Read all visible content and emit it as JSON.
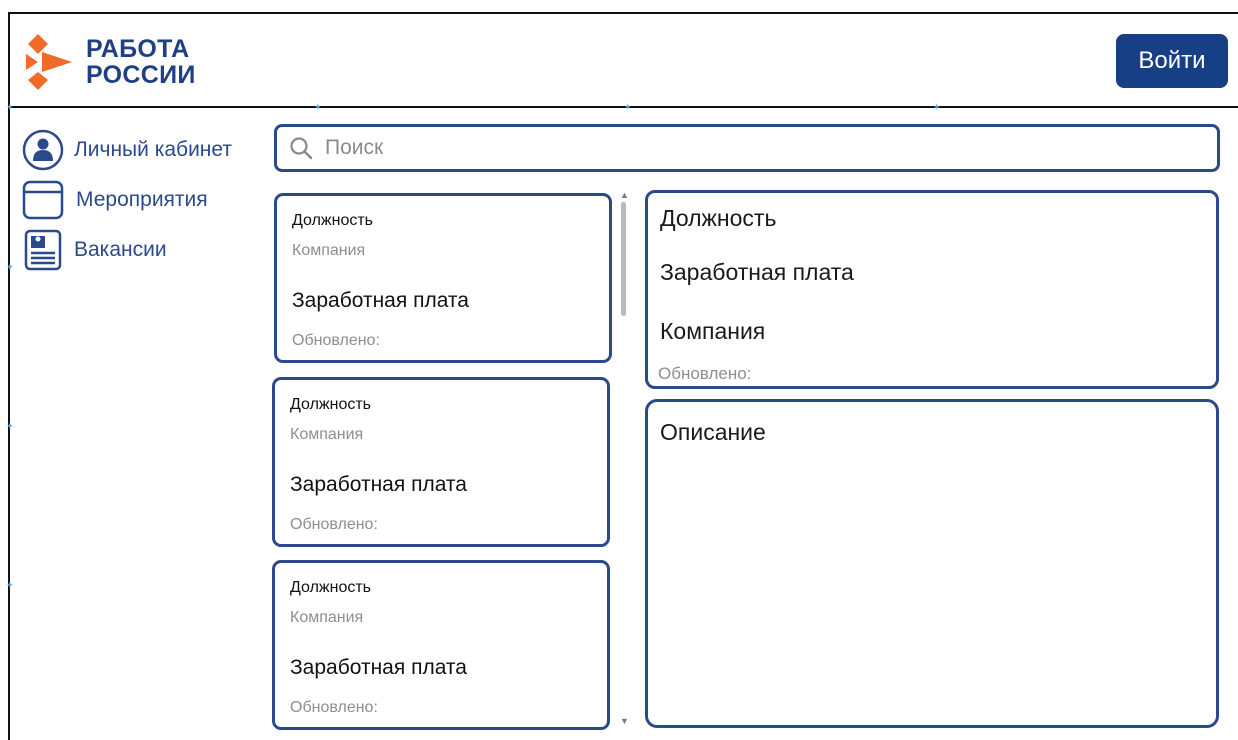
{
  "brand": {
    "line1": "РАБОТА",
    "line2": "РОССИИ",
    "color": "#1f3f86",
    "accent": "#f26a2a"
  },
  "header": {
    "login_label": "Войти"
  },
  "sidebar": {
    "items": [
      {
        "label": "Личный кабинет",
        "icon": "user-circle-icon"
      },
      {
        "label": "Мероприятия",
        "icon": "calendar-icon"
      },
      {
        "label": "Вакансии",
        "icon": "document-icon"
      }
    ]
  },
  "search": {
    "placeholder": "Поиск",
    "icon": "search-icon"
  },
  "vacancies": [
    {
      "position": "Должность",
      "company": "Компания",
      "salary": "Заработная плата",
      "updated": "Обновлено:"
    },
    {
      "position": "Должность",
      "company": "Компания",
      "salary": "Заработная плата",
      "updated": "Обновлено:"
    },
    {
      "position": "Должность",
      "company": "Компания",
      "salary": "Заработная плата",
      "updated": "Обновлено:"
    }
  ],
  "detail": {
    "position": "Должность",
    "salary": "Заработная плата",
    "company": "Компания",
    "updated": "Обновлено:",
    "description_title": "Описание"
  },
  "colors": {
    "primary": "#2b4a8c",
    "button": "#173f85",
    "muted": "#8e8e8e"
  }
}
